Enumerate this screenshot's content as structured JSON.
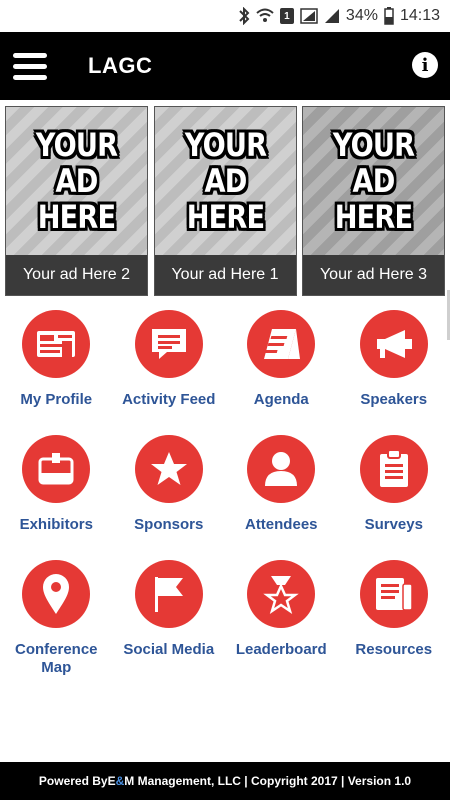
{
  "status_bar": {
    "battery_percent": "34%",
    "time": "14:13",
    "sim_label": "1"
  },
  "app_bar": {
    "title": "LAGC",
    "info_glyph": "i"
  },
  "ads": [
    {
      "headline": "YOUR AD HERE",
      "caption": "Your ad Here 2"
    },
    {
      "headline": "YOUR AD HERE",
      "caption": "Your ad Here 1"
    },
    {
      "headline": "YOUR AD HERE",
      "caption": "Your ad Here 3"
    }
  ],
  "grid": [
    {
      "label": "My Profile",
      "icon": "profile-card-icon"
    },
    {
      "label": "Activity Feed",
      "icon": "chat-bubble-icon"
    },
    {
      "label": "Agenda",
      "icon": "agenda-sign-icon"
    },
    {
      "label": "Speakers",
      "icon": "megaphone-icon"
    },
    {
      "label": "Exhibitors",
      "icon": "badge-icon"
    },
    {
      "label": "Sponsors",
      "icon": "star-icon"
    },
    {
      "label": "Attendees",
      "icon": "person-icon"
    },
    {
      "label": "Surveys",
      "icon": "clipboard-icon"
    },
    {
      "label": "Conference Map",
      "icon": "map-pin-icon"
    },
    {
      "label": "Social Media",
      "icon": "flag-icon"
    },
    {
      "label": "Leaderboard",
      "icon": "trophy-star-icon"
    },
    {
      "label": "Resources",
      "icon": "folder-icon"
    }
  ],
  "footer": {
    "powered_by": "Powered By ",
    "company_e": "E",
    "company_amp": "&",
    "company_m": "M",
    "rest": " Management, LLC | Copyright 2017 | Version 1.0"
  },
  "colors": {
    "accent_red": "#e53935",
    "label_blue": "#2e5597",
    "bar_black": "#000000"
  }
}
